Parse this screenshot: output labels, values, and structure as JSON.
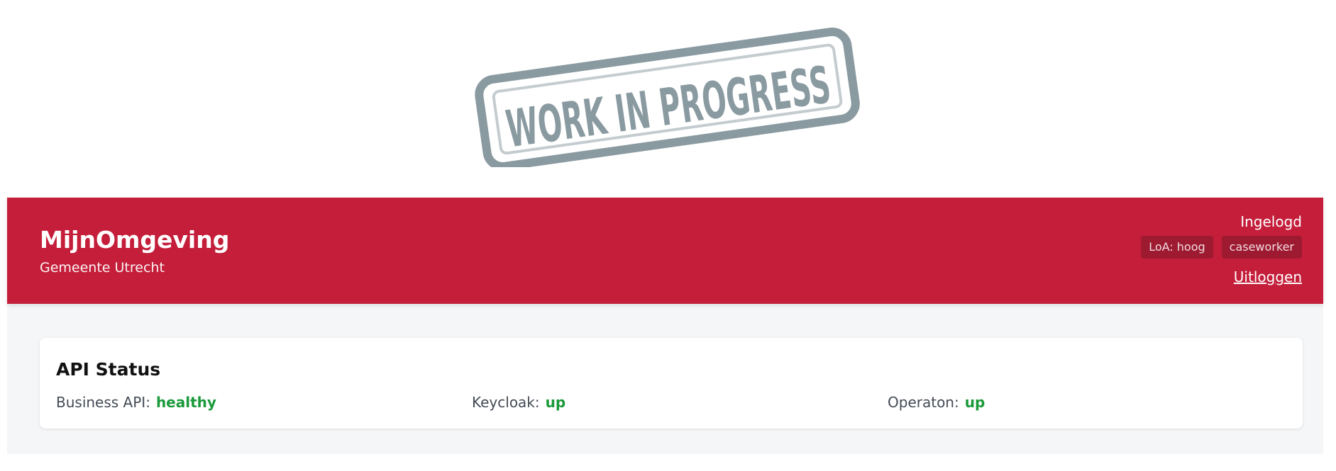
{
  "banner": {
    "stamp_text": "WORK IN PROGRESS",
    "stamp_color": "#8a9aa1"
  },
  "header": {
    "app_name": "MijnOmgeving",
    "organization": "Gemeente Utrecht",
    "background_color": "#c41e3a",
    "logged_in_label": "Ingelogd",
    "badges": [
      "LoA: hoog",
      "caseworker"
    ],
    "logout_label": "Uitloggen"
  },
  "api_status": {
    "title": "API Status",
    "services": [
      {
        "label": "Business API:",
        "value": "healthy"
      },
      {
        "label": "Keycloak:",
        "value": "up"
      },
      {
        "label": "Operaton:",
        "value": "up"
      }
    ],
    "ok_color": "#1a9a3a"
  }
}
